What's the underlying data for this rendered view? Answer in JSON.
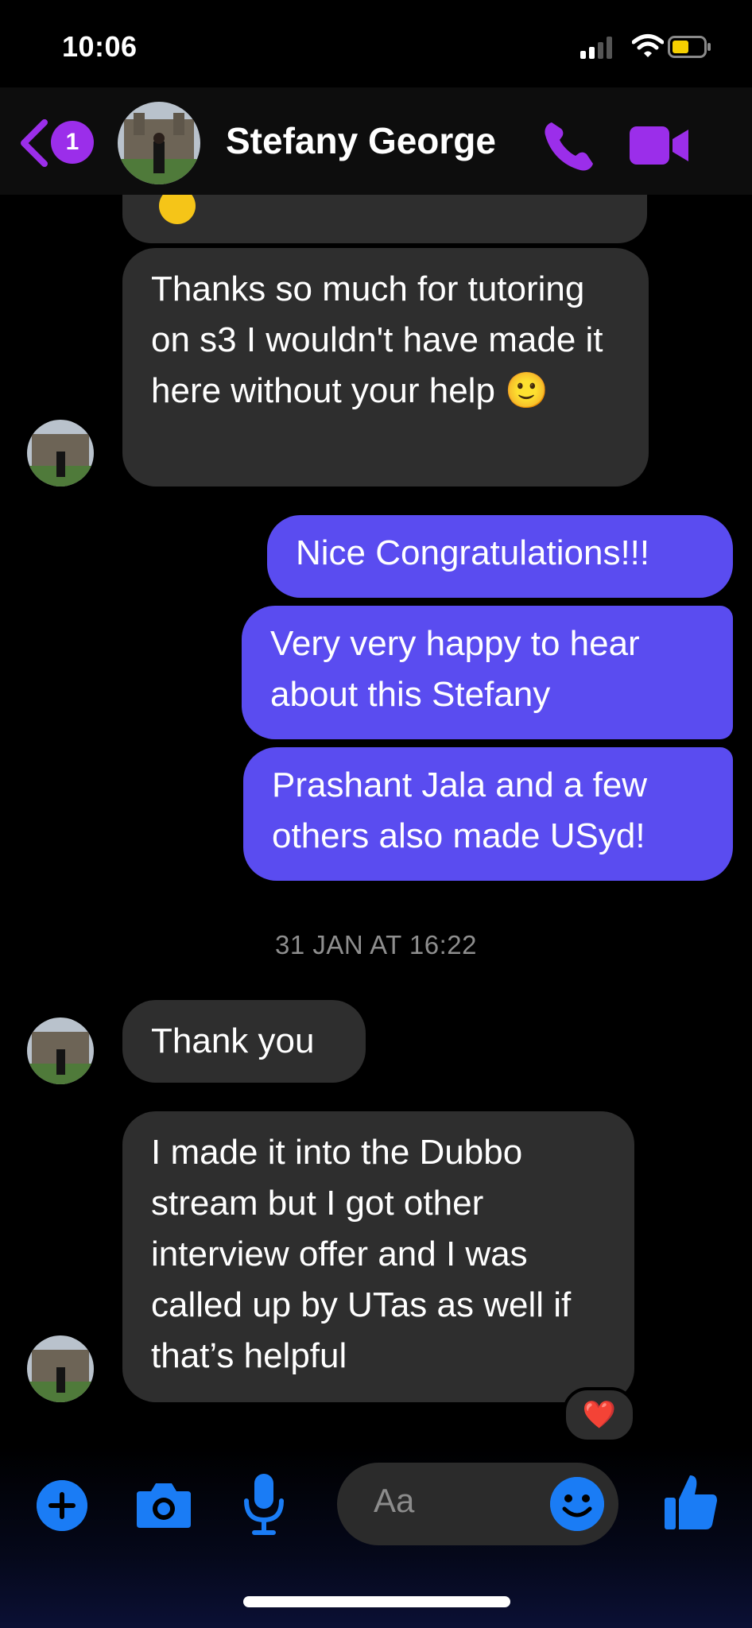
{
  "status_bar": {
    "time": "10:06"
  },
  "header": {
    "unread_count": "1",
    "contact_name": "Stefany George"
  },
  "messages": [
    {
      "from": "them",
      "text": "Thanks so much for tutoring on s3 I wouldn't have made it here without your help 🙂"
    },
    {
      "from": "me",
      "text": "Nice Congratulations!!!"
    },
    {
      "from": "me",
      "text": "Very very happy to hear about this Stefany"
    },
    {
      "from": "me",
      "text": "Prashant Jala and a few others also made USyd!"
    },
    {
      "from": "them",
      "text": "Thank you"
    },
    {
      "from": "them",
      "text": "I made it into the Dubbo stream but I got other interview offer and I was called up by UTas as well if that’s helpful",
      "reaction": "❤️"
    }
  ],
  "timestamp": "31 JAN AT 16:22",
  "composer": {
    "placeholder": "Aa"
  },
  "colors": {
    "accent": "#9b2eea",
    "sent_bubble": "#5a4cf0",
    "received_bubble": "#2e2e2e",
    "action_blue": "#1a7cf5"
  }
}
